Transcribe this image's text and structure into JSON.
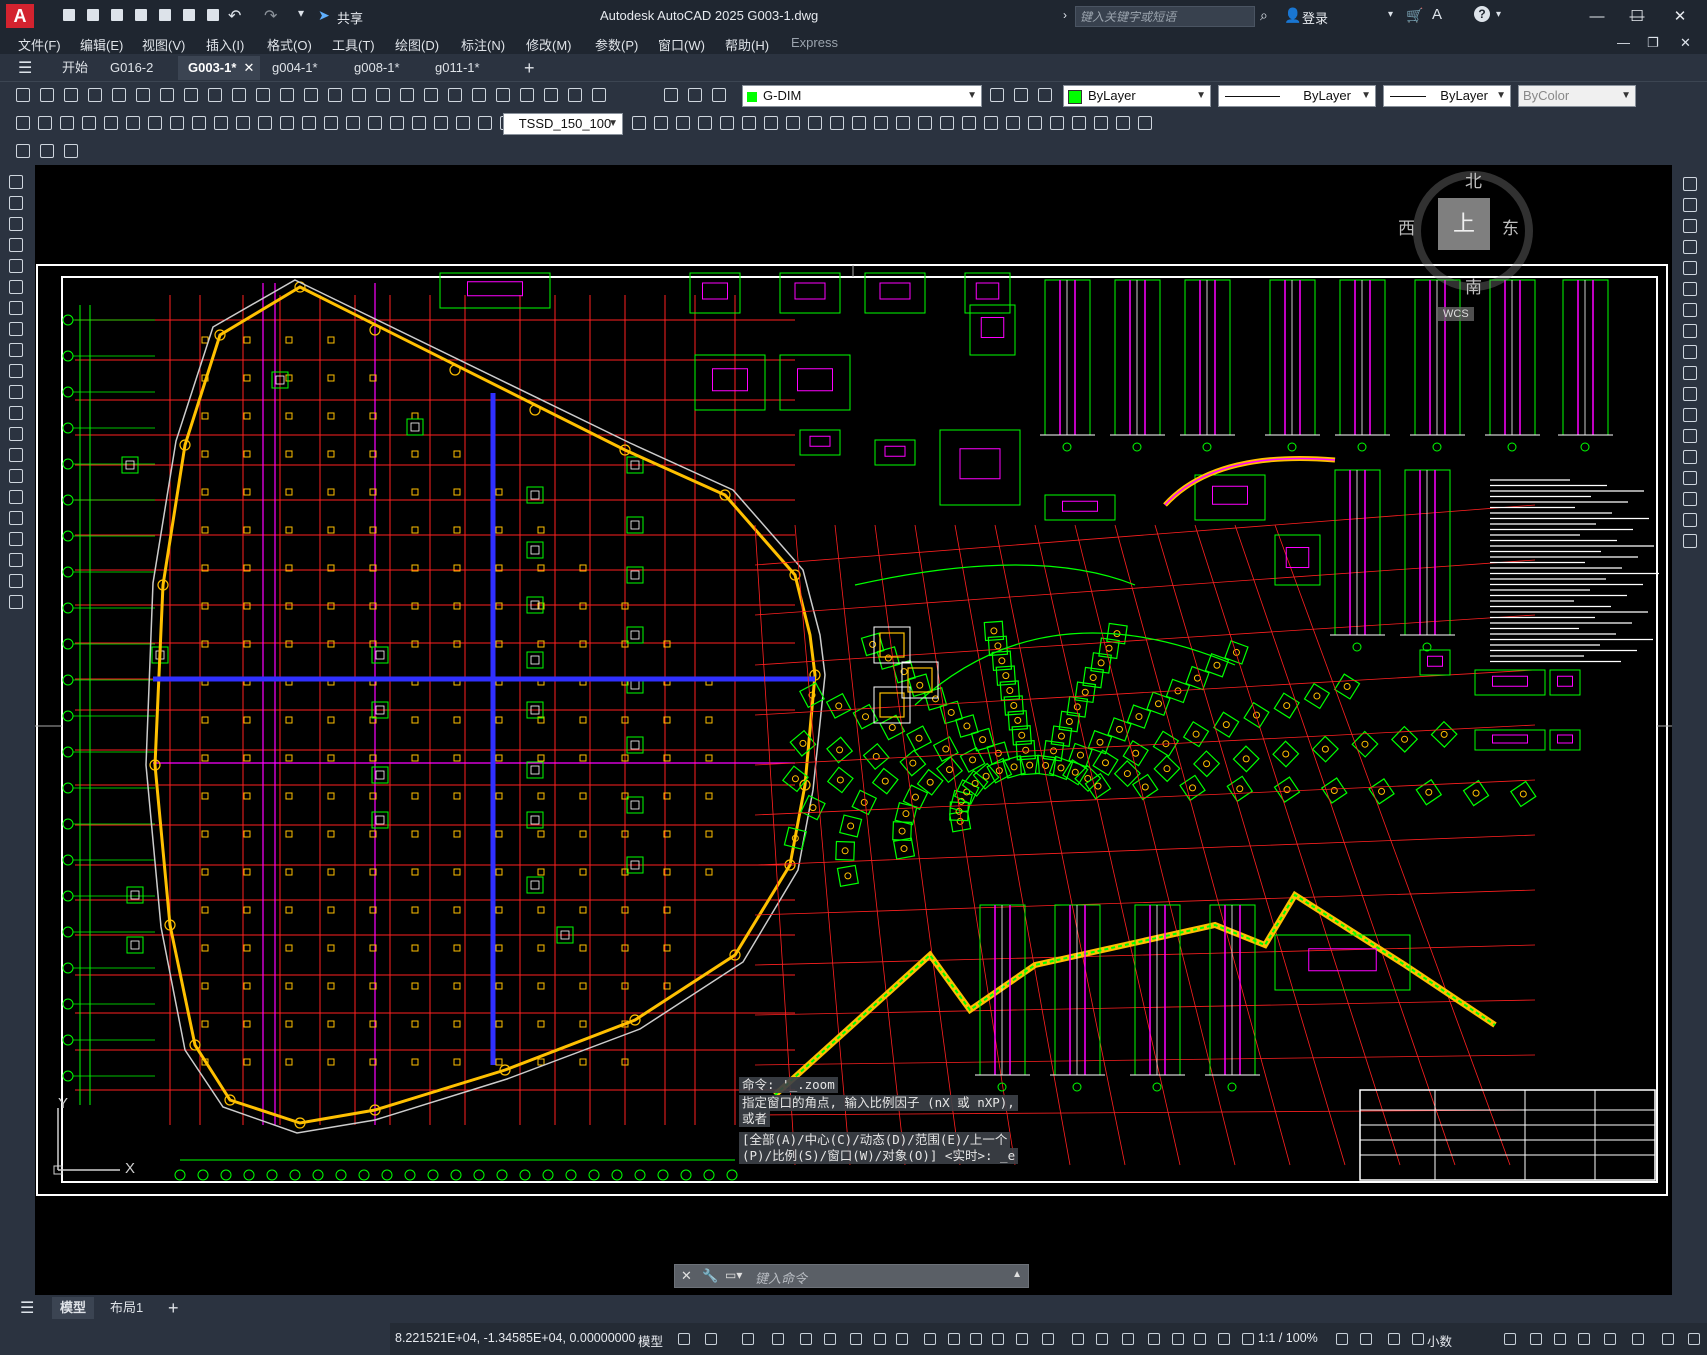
{
  "app": {
    "logo": "A",
    "title": "Autodesk AutoCAD 2025    G003-1.dwg",
    "share_label": "共享",
    "search_placeholder": "键入关键字或短语",
    "login_label": "登录"
  },
  "menu": [
    "文件(F)",
    "编辑(E)",
    "视图(V)",
    "插入(I)",
    "格式(O)",
    "工具(T)",
    "绘图(D)",
    "标注(N)",
    "修改(M)",
    "参数(P)",
    "窗口(W)",
    "帮助(H)",
    "Express"
  ],
  "tabs": {
    "start": "开始",
    "items": [
      "G016-2",
      "G003-1*",
      "g004-1*",
      "g008-1*",
      "g011-1*"
    ],
    "active": "G003-1*",
    "add": "+"
  },
  "toolbar": {
    "layer_value": "G-DIM",
    "color_value": "ByLayer",
    "linetype_value": "ByLayer",
    "lineweight_value": "ByLayer",
    "plotstyle_value": "ByColor",
    "dimstyle_value": "TSSD_150_100"
  },
  "viewcube": {
    "north": "北",
    "south": "南",
    "east": "东",
    "west": "西",
    "face": "上",
    "wcs": "WCS"
  },
  "ucs": {
    "y": "Y",
    "x": "X"
  },
  "command": {
    "history": [
      "命令: '_.zoom",
      "指定窗口的角点, 输入比例因子 (nX 或 nXP),",
      "或者",
      "[全部(A)/中心(C)/动态(D)/范围(E)/上一个",
      "(P)/比例(S)/窗口(W)/对象(O)] <实时>: _e"
    ],
    "placeholder": "键入命令"
  },
  "layouts": {
    "model": "模型",
    "layout1": "布局1",
    "add": "+"
  },
  "status": {
    "coords": "8.221521E+04, -1.34585E+04, 0.00000000",
    "model": "模型",
    "scale": "1:1 / 100%",
    "units": "小数"
  },
  "drawing": {
    "accent_yellow": "#ffc000",
    "accent_red": "#ff2020",
    "accent_green": "#00ff00",
    "accent_magenta": "#ff00ff",
    "accent_blue": "#3030ff"
  }
}
